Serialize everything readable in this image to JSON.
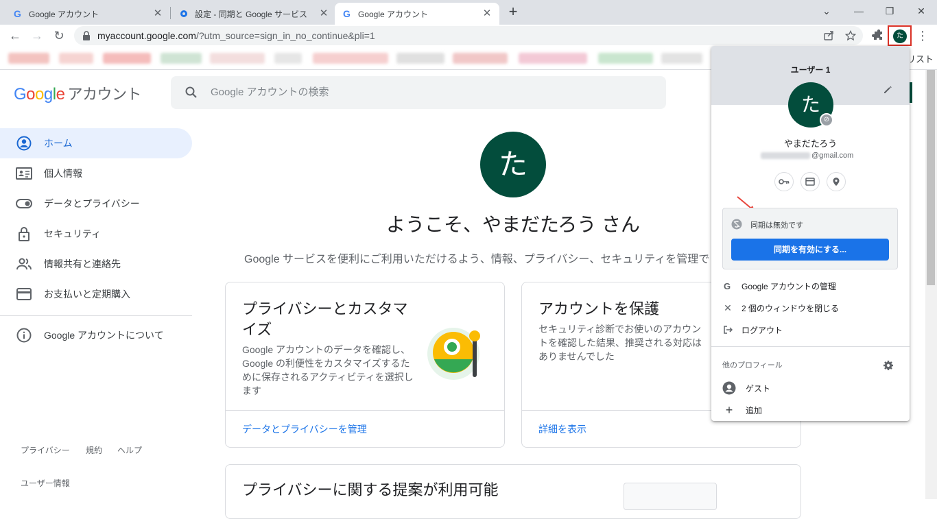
{
  "browser": {
    "tabs": [
      {
        "title": "Google アカウント",
        "active": false
      },
      {
        "title": "設定 - 同期と Google サービス",
        "active": false
      },
      {
        "title": "Google アカウント",
        "active": true
      }
    ],
    "url_host": "myaccount.google.com",
    "url_rest": "/?utm_source=sign_in_no_continue&pli=1",
    "profile_initial": "た",
    "bookmarks_trailing": "リスト"
  },
  "header": {
    "logo_letters": [
      "G",
      "o",
      "o",
      "g",
      "l",
      "e"
    ],
    "logo_colors": [
      "#4285f4",
      "#ea4335",
      "#fbbc05",
      "#4285f4",
      "#34a853",
      "#ea4335"
    ],
    "logo_suffix": "アカウント",
    "search_placeholder": "Google アカウントの検索"
  },
  "sidebar": {
    "items": [
      {
        "label": "ホーム",
        "icon": "account-circle-icon"
      },
      {
        "label": "個人情報",
        "icon": "id-card-icon"
      },
      {
        "label": "データとプライバシー",
        "icon": "toggle-icon"
      },
      {
        "label": "セキュリティ",
        "icon": "lock-icon"
      },
      {
        "label": "情報共有と連絡先",
        "icon": "people-icon"
      },
      {
        "label": "お支払いと定期購入",
        "icon": "credit-card-icon"
      }
    ],
    "about": "Google アカウントについて",
    "footer": [
      "プライバシー",
      "規約",
      "ヘルプ"
    ],
    "user_info": "ユーザー情報"
  },
  "main": {
    "avatar_initial": "た",
    "welcome": "ようこそ、やまだたろう さん",
    "subtitle": "Google サービスを便利にご利用いただけるよう、情報、プライバシー、セキュリティを管理で",
    "cards": [
      {
        "title": "プライバシーとカスタマイズ",
        "desc": "Google アカウントのデータを確認し、Google の利便性をカスタマイズするために保存されるアクティビティを選択します",
        "link": "データとプライバシーを管理"
      },
      {
        "title": "アカウントを保護",
        "desc": "セキュリティ診断でお使いのアカウントを確認した結果、推奨される対応はありませんでした",
        "link": "詳細を表示"
      }
    ],
    "bottom_card_title": "プライバシーに関する提案が利用可能"
  },
  "popup": {
    "header": "ユーザー 1",
    "avatar_initial": "た",
    "name": "やまだたろう",
    "email_suffix": "@gmail.com",
    "sync_status": "同期は無効です",
    "sync_button": "同期を有効にする...",
    "menu": [
      {
        "label": "Google アカウントの管理",
        "icon": "google-g-icon"
      },
      {
        "label": "2 個のウィンドウを閉じる",
        "icon": "close-icon"
      },
      {
        "label": "ログアウト",
        "icon": "logout-icon"
      }
    ],
    "other_profiles": "他のプロフィール",
    "guest": "ゲスト",
    "add": "追加"
  },
  "colors": {
    "accent": "#1a73e8",
    "avatar": "#034d3c",
    "highlight": "#d93025"
  }
}
